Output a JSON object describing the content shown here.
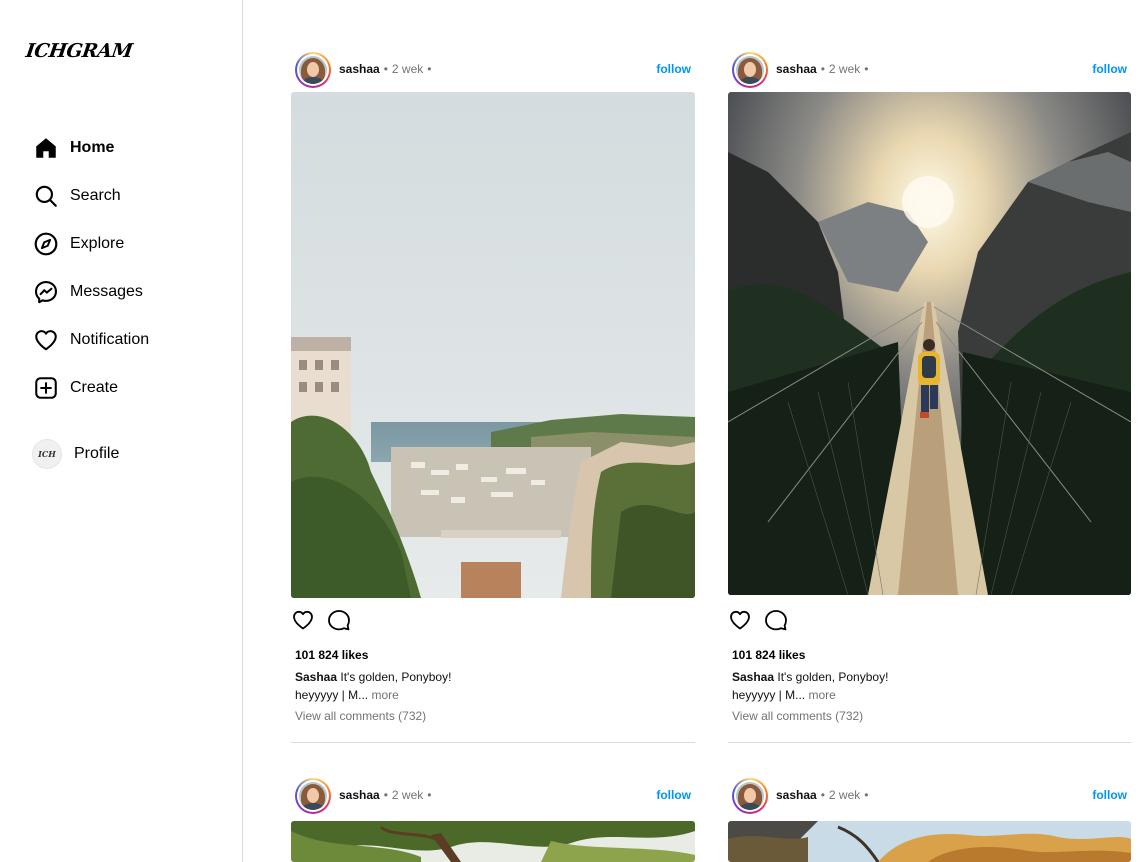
{
  "app": {
    "logo": "ICHGRAM"
  },
  "sidebar": {
    "items": [
      {
        "label": "Home",
        "icon": "home-icon"
      },
      {
        "label": "Search",
        "icon": "search-icon"
      },
      {
        "label": "Explore",
        "icon": "compass-icon"
      },
      {
        "label": "Messages",
        "icon": "messenger-icon"
      },
      {
        "label": "Notification",
        "icon": "heart-icon"
      },
      {
        "label": "Create",
        "icon": "plus-square-icon"
      }
    ],
    "profile": {
      "label": "Profile",
      "avatar_text": "ICH"
    }
  },
  "posts": [
    {
      "username": "sashaa",
      "sep1": "•",
      "time": "2 wek",
      "sep2": "•",
      "follow": "follow",
      "photo": "monaco-harbor-photo",
      "likes": "101 824 likes",
      "caption_user": "Sashaa",
      "caption_text": "It's golden, Ponyboy!",
      "caption_line2": "heyyyyy | M...",
      "more": "more",
      "comments": "View all comments (732)"
    },
    {
      "username": "sashaa",
      "sep1": "•",
      "time": "2 wek",
      "sep2": "•",
      "follow": "follow",
      "photo": "suspension-bridge-photo",
      "likes": "101 824 likes",
      "caption_user": "Sashaa",
      "caption_text": "It's golden, Ponyboy!",
      "caption_line2": "heyyyyy | M...",
      "more": "more",
      "comments": "View all comments (732)"
    },
    {
      "username": "sashaa",
      "sep1": "•",
      "time": "2 wek",
      "sep2": "•",
      "follow": "follow",
      "photo": "tree-canopy-photo"
    },
    {
      "username": "sashaa",
      "sep1": "•",
      "time": "2 wek",
      "sep2": "•",
      "follow": "follow",
      "photo": "autumn-trees-photo"
    }
  ],
  "colors": {
    "accent": "#0095f6",
    "muted": "#737373",
    "border": "#dbdbdb"
  }
}
